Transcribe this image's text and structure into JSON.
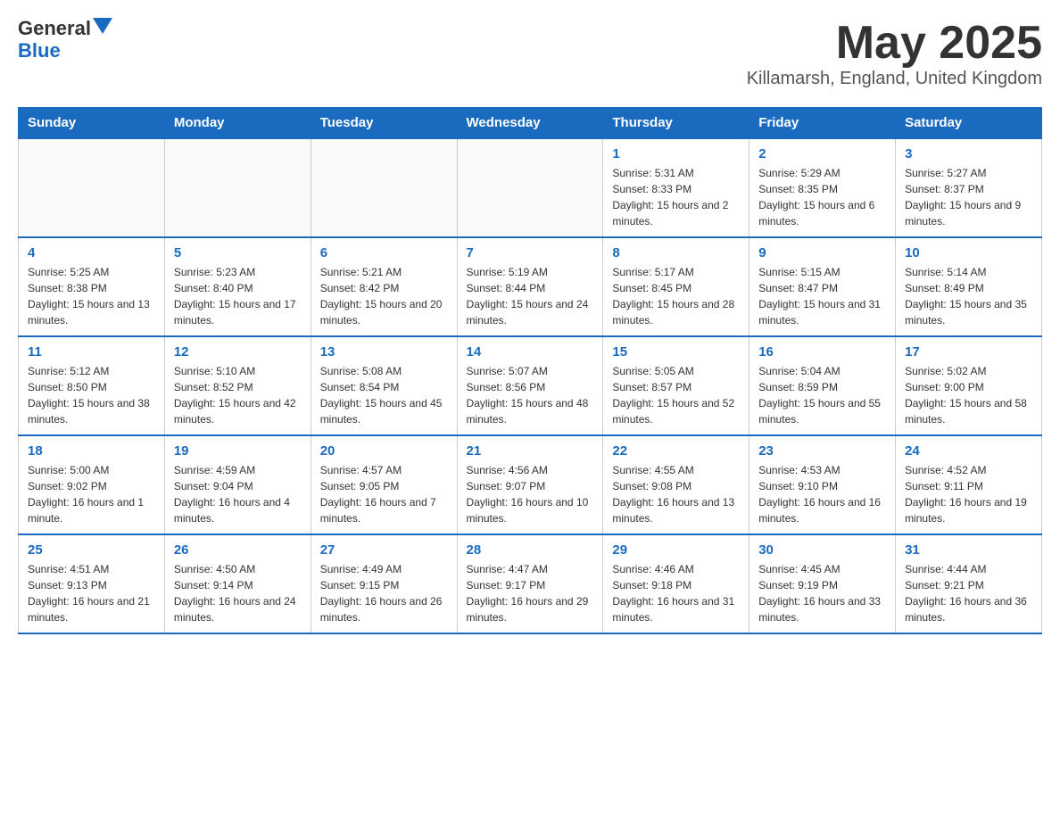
{
  "header": {
    "logo_general": "General",
    "logo_blue": "Blue",
    "month_title": "May 2025",
    "location": "Killamarsh, England, United Kingdom"
  },
  "weekdays": [
    "Sunday",
    "Monday",
    "Tuesday",
    "Wednesday",
    "Thursday",
    "Friday",
    "Saturday"
  ],
  "weeks": [
    [
      {
        "day": "",
        "info": ""
      },
      {
        "day": "",
        "info": ""
      },
      {
        "day": "",
        "info": ""
      },
      {
        "day": "",
        "info": ""
      },
      {
        "day": "1",
        "info": "Sunrise: 5:31 AM\nSunset: 8:33 PM\nDaylight: 15 hours and 2 minutes."
      },
      {
        "day": "2",
        "info": "Sunrise: 5:29 AM\nSunset: 8:35 PM\nDaylight: 15 hours and 6 minutes."
      },
      {
        "day": "3",
        "info": "Sunrise: 5:27 AM\nSunset: 8:37 PM\nDaylight: 15 hours and 9 minutes."
      }
    ],
    [
      {
        "day": "4",
        "info": "Sunrise: 5:25 AM\nSunset: 8:38 PM\nDaylight: 15 hours and 13 minutes."
      },
      {
        "day": "5",
        "info": "Sunrise: 5:23 AM\nSunset: 8:40 PM\nDaylight: 15 hours and 17 minutes."
      },
      {
        "day": "6",
        "info": "Sunrise: 5:21 AM\nSunset: 8:42 PM\nDaylight: 15 hours and 20 minutes."
      },
      {
        "day": "7",
        "info": "Sunrise: 5:19 AM\nSunset: 8:44 PM\nDaylight: 15 hours and 24 minutes."
      },
      {
        "day": "8",
        "info": "Sunrise: 5:17 AM\nSunset: 8:45 PM\nDaylight: 15 hours and 28 minutes."
      },
      {
        "day": "9",
        "info": "Sunrise: 5:15 AM\nSunset: 8:47 PM\nDaylight: 15 hours and 31 minutes."
      },
      {
        "day": "10",
        "info": "Sunrise: 5:14 AM\nSunset: 8:49 PM\nDaylight: 15 hours and 35 minutes."
      }
    ],
    [
      {
        "day": "11",
        "info": "Sunrise: 5:12 AM\nSunset: 8:50 PM\nDaylight: 15 hours and 38 minutes."
      },
      {
        "day": "12",
        "info": "Sunrise: 5:10 AM\nSunset: 8:52 PM\nDaylight: 15 hours and 42 minutes."
      },
      {
        "day": "13",
        "info": "Sunrise: 5:08 AM\nSunset: 8:54 PM\nDaylight: 15 hours and 45 minutes."
      },
      {
        "day": "14",
        "info": "Sunrise: 5:07 AM\nSunset: 8:56 PM\nDaylight: 15 hours and 48 minutes."
      },
      {
        "day": "15",
        "info": "Sunrise: 5:05 AM\nSunset: 8:57 PM\nDaylight: 15 hours and 52 minutes."
      },
      {
        "day": "16",
        "info": "Sunrise: 5:04 AM\nSunset: 8:59 PM\nDaylight: 15 hours and 55 minutes."
      },
      {
        "day": "17",
        "info": "Sunrise: 5:02 AM\nSunset: 9:00 PM\nDaylight: 15 hours and 58 minutes."
      }
    ],
    [
      {
        "day": "18",
        "info": "Sunrise: 5:00 AM\nSunset: 9:02 PM\nDaylight: 16 hours and 1 minute."
      },
      {
        "day": "19",
        "info": "Sunrise: 4:59 AM\nSunset: 9:04 PM\nDaylight: 16 hours and 4 minutes."
      },
      {
        "day": "20",
        "info": "Sunrise: 4:57 AM\nSunset: 9:05 PM\nDaylight: 16 hours and 7 minutes."
      },
      {
        "day": "21",
        "info": "Sunrise: 4:56 AM\nSunset: 9:07 PM\nDaylight: 16 hours and 10 minutes."
      },
      {
        "day": "22",
        "info": "Sunrise: 4:55 AM\nSunset: 9:08 PM\nDaylight: 16 hours and 13 minutes."
      },
      {
        "day": "23",
        "info": "Sunrise: 4:53 AM\nSunset: 9:10 PM\nDaylight: 16 hours and 16 minutes."
      },
      {
        "day": "24",
        "info": "Sunrise: 4:52 AM\nSunset: 9:11 PM\nDaylight: 16 hours and 19 minutes."
      }
    ],
    [
      {
        "day": "25",
        "info": "Sunrise: 4:51 AM\nSunset: 9:13 PM\nDaylight: 16 hours and 21 minutes."
      },
      {
        "day": "26",
        "info": "Sunrise: 4:50 AM\nSunset: 9:14 PM\nDaylight: 16 hours and 24 minutes."
      },
      {
        "day": "27",
        "info": "Sunrise: 4:49 AM\nSunset: 9:15 PM\nDaylight: 16 hours and 26 minutes."
      },
      {
        "day": "28",
        "info": "Sunrise: 4:47 AM\nSunset: 9:17 PM\nDaylight: 16 hours and 29 minutes."
      },
      {
        "day": "29",
        "info": "Sunrise: 4:46 AM\nSunset: 9:18 PM\nDaylight: 16 hours and 31 minutes."
      },
      {
        "day": "30",
        "info": "Sunrise: 4:45 AM\nSunset: 9:19 PM\nDaylight: 16 hours and 33 minutes."
      },
      {
        "day": "31",
        "info": "Sunrise: 4:44 AM\nSunset: 9:21 PM\nDaylight: 16 hours and 36 minutes."
      }
    ]
  ]
}
